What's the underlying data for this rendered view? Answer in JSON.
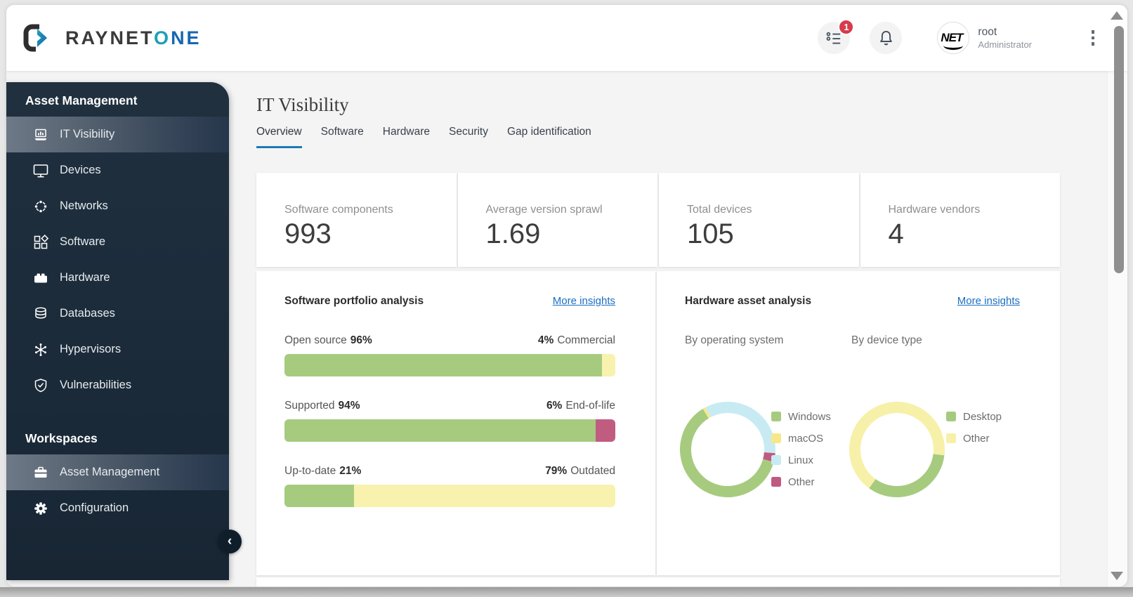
{
  "brand": {
    "name_primary": "RAYNET",
    "name_secondary_o": "O",
    "name_secondary_ne": "NE"
  },
  "header": {
    "tasks_badge": "1",
    "user_name": "root",
    "user_role": "Administrator",
    "avatar_text": "NET"
  },
  "sidebar": {
    "sections": [
      {
        "title": "Asset Management",
        "items": [
          {
            "label": "IT Visibility",
            "active": true
          },
          {
            "label": "Devices"
          },
          {
            "label": "Networks"
          },
          {
            "label": "Software"
          },
          {
            "label": "Hardware"
          },
          {
            "label": "Databases"
          },
          {
            "label": "Hypervisors"
          },
          {
            "label": "Vulnerabilities"
          }
        ]
      },
      {
        "title": "Workspaces",
        "items": [
          {
            "label": "Asset Management",
            "active": true
          },
          {
            "label": "Configuration"
          }
        ]
      }
    ],
    "collapse_glyph": "‹"
  },
  "page": {
    "title": "IT Visibility",
    "tabs": [
      {
        "label": "Overview",
        "active": true
      },
      {
        "label": "Software"
      },
      {
        "label": "Hardware"
      },
      {
        "label": "Security"
      },
      {
        "label": "Gap identification"
      }
    ]
  },
  "stats": [
    {
      "label": "Software components",
      "value": "993"
    },
    {
      "label": "Average version sprawl",
      "value": "1.69"
    },
    {
      "label": "Total devices",
      "value": "105"
    },
    {
      "label": "Hardware vendors",
      "value": "4"
    }
  ],
  "software_panel": {
    "title": "Software portfolio analysis",
    "more_link": "More insights",
    "bars": [
      {
        "left_label": "Open source",
        "left_pct": "96%",
        "left_value": 96,
        "left_color": "#a6cb7f",
        "right_pct": "4%",
        "right_label": "Commercial",
        "right_value": 4,
        "right_color": "#f8f2ae"
      },
      {
        "left_label": "Supported",
        "left_pct": "94%",
        "left_value": 94,
        "left_color": "#a6cb7f",
        "right_pct": "6%",
        "right_label": "End-of-life",
        "right_value": 6,
        "right_color": "#c15c81"
      },
      {
        "left_label": "Up-to-date",
        "left_pct": "21%",
        "left_value": 21,
        "left_color": "#a6cb7f",
        "right_pct": "79%",
        "right_label": "Outdated",
        "right_value": 79,
        "right_color": "#f8f2ae"
      }
    ]
  },
  "hardware_panel": {
    "title": "Hardware asset analysis",
    "more_link": "More insights",
    "donuts": [
      {
        "label": "By operating system",
        "type": "pie",
        "rotate_deg": -28,
        "draw_order": [
          2,
          3,
          0,
          1
        ],
        "legend": [
          {
            "name": "Windows",
            "value": 62,
            "color": "#a6cb7f"
          },
          {
            "name": "macOS",
            "value": 1,
            "color": "#f8e789"
          },
          {
            "name": "Linux",
            "value": 34,
            "color": "#c8ebf3"
          },
          {
            "name": "Other",
            "value": 3,
            "color": "#bf5a80"
          }
        ]
      },
      {
        "label": "By device type",
        "type": "pie",
        "rotate_deg": 97,
        "draw_order": [
          0,
          1
        ],
        "legend": [
          {
            "name": "Desktop",
            "value": 33,
            "color": "#a6cb7f"
          },
          {
            "name": "Other",
            "value": 67,
            "color": "#f7f0a8"
          }
        ]
      }
    ]
  }
}
